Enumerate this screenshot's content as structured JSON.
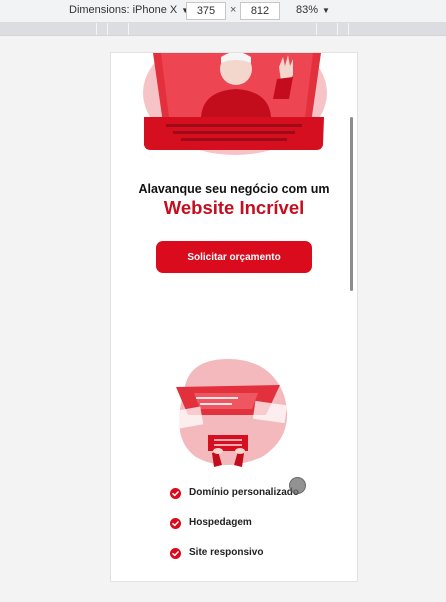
{
  "devtools": {
    "device_label": "Dimensions: iPhone X",
    "width_value": "375",
    "times_sign": "×",
    "height_value": "812",
    "zoom_label": "83%"
  },
  "hero": {
    "headline": "Alavanque seu negócio com um",
    "headline_accent": "Website Incrível",
    "cta_label": "Solicitar orçamento"
  },
  "features": {
    "items": [
      {
        "label": "Domínio personalizado",
        "icon": "check-circle-icon"
      },
      {
        "label": "Hospedagem",
        "icon": "check-circle-icon"
      },
      {
        "label": "Site responsivo",
        "icon": "check-circle-icon"
      }
    ]
  },
  "colors": {
    "accent": "#d90b1c",
    "accent_dark": "#c50e1f",
    "blob_pink": "#f4b9bd",
    "toolbar_bg": "#f1f3f4"
  }
}
